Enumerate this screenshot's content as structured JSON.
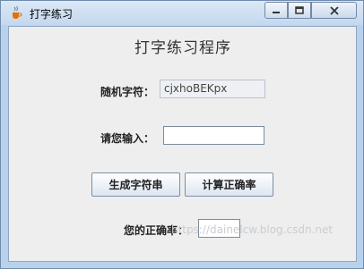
{
  "window": {
    "title": "打字练习",
    "icon": "java-cup-icon"
  },
  "controls": {
    "minimize": "minimize-icon",
    "maximize": "maximize-icon",
    "close": "close-icon"
  },
  "content": {
    "heading": "打字练习程序",
    "random_label": "随机字符：",
    "random_value": "cjxhoBEKpx",
    "input_label": "请您输入：",
    "input_value": "",
    "generate_button": "生成字符串",
    "calculate_button": "计算正确率",
    "accuracy_label": "您的正确率：",
    "accuracy_value": ""
  },
  "watermark": "https://dainelcw.blog.csdn.net"
}
